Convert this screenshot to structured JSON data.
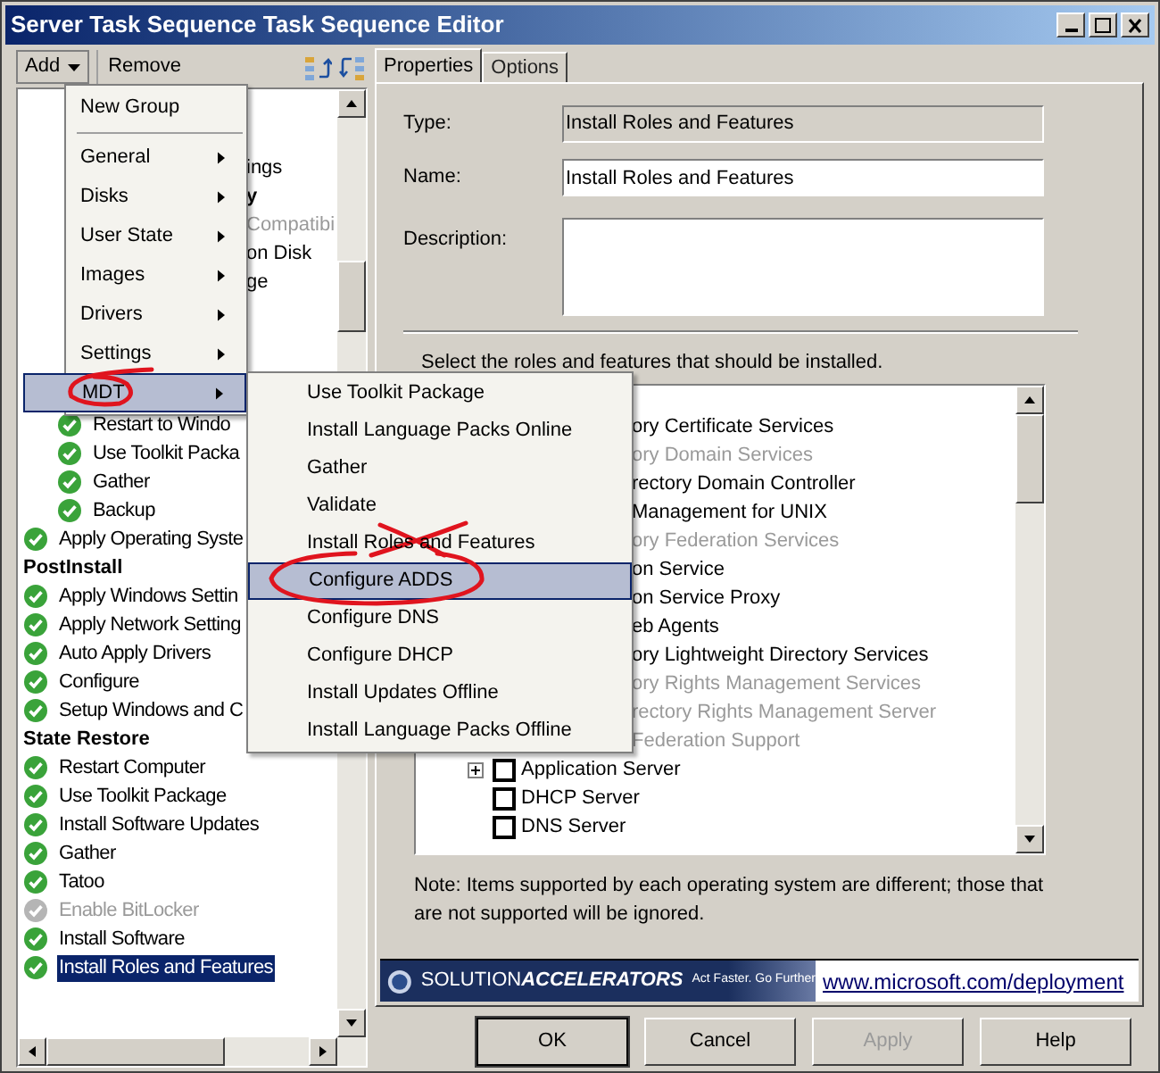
{
  "window": {
    "title": "Server Task Sequence Task Sequence Editor"
  },
  "toolbar": {
    "add_button": "Add",
    "remove_button": "Remove"
  },
  "tree": {
    "rows": [
      {
        "kind": "fragment",
        "label": "ings",
        "bold": false,
        "disabled": false
      },
      {
        "kind": "fragment",
        "label": "y",
        "bold": true,
        "disabled": false
      },
      {
        "kind": "fragment",
        "label": "Compatibi",
        "bold": false,
        "disabled": true
      },
      {
        "kind": "fragment",
        "label": "on Disk",
        "bold": false,
        "disabled": false
      },
      {
        "kind": "fragment",
        "label": "ge",
        "bold": false,
        "disabled": false
      },
      {
        "kind": "covered",
        "children": [
          {
            "kind": "covered",
            "children": [
              {
                "kind": "step",
                "label": "Restart to Windo",
                "disabled": false,
                "selected": false
              },
              {
                "kind": "step",
                "label": "Use Toolkit Packa",
                "disabled": false,
                "selected": false
              },
              {
                "kind": "step",
                "label": "Gather",
                "disabled": false,
                "selected": false
              },
              {
                "kind": "step",
                "label": "Backup",
                "disabled": false,
                "selected": false
              }
            ]
          },
          {
            "kind": "step",
            "label": "Apply Operating Syste",
            "disabled": false,
            "selected": false
          }
        ]
      },
      {
        "kind": "group",
        "label": "PostInstall",
        "children": [
          {
            "kind": "step",
            "label": "Apply Windows Settin",
            "disabled": false,
            "selected": false
          },
          {
            "kind": "step",
            "label": "Apply Network Setting",
            "disabled": false,
            "selected": false
          },
          {
            "kind": "step",
            "label": "Auto Apply Drivers",
            "disabled": false,
            "selected": false
          },
          {
            "kind": "step",
            "label": "Configure",
            "disabled": false,
            "selected": false
          },
          {
            "kind": "step",
            "label": "Setup Windows and C",
            "disabled": false,
            "selected": false
          }
        ]
      },
      {
        "kind": "group",
        "label": "State Restore",
        "children": [
          {
            "kind": "step",
            "label": "Restart Computer",
            "disabled": false,
            "selected": false
          },
          {
            "kind": "step",
            "label": "Use Toolkit Package",
            "disabled": false,
            "selected": false
          },
          {
            "kind": "step",
            "label": "Install Software Updates",
            "disabled": false,
            "selected": false
          },
          {
            "kind": "step",
            "label": "Gather",
            "disabled": false,
            "selected": false
          },
          {
            "kind": "step",
            "label": "Tatoo",
            "disabled": false,
            "selected": false
          },
          {
            "kind": "step",
            "label": "Enable BitLocker",
            "disabled": true,
            "selected": false
          },
          {
            "kind": "step",
            "label": "Install Software",
            "disabled": false,
            "selected": false
          },
          {
            "kind": "step",
            "label": "Install Roles and Features",
            "disabled": false,
            "selected": true
          }
        ]
      }
    ]
  },
  "add_menu": {
    "items": [
      {
        "kind": "item",
        "label": "New Group",
        "submenu": false,
        "selected": false
      },
      {
        "kind": "separator"
      },
      {
        "kind": "item",
        "label": "General",
        "submenu": true,
        "selected": false
      },
      {
        "kind": "item",
        "label": "Disks",
        "submenu": true,
        "selected": false
      },
      {
        "kind": "item",
        "label": "User State",
        "submenu": true,
        "selected": false
      },
      {
        "kind": "item",
        "label": "Images",
        "submenu": true,
        "selected": false
      },
      {
        "kind": "item",
        "label": "Drivers",
        "submenu": true,
        "selected": false
      },
      {
        "kind": "item",
        "label": "Settings",
        "submenu": true,
        "selected": false
      },
      {
        "kind": "item",
        "label": "MDT",
        "submenu": true,
        "selected": true
      }
    ]
  },
  "mdt_submenu": {
    "items": [
      {
        "label": "Use Toolkit Package",
        "selected": false
      },
      {
        "label": "Install Language Packs Online",
        "selected": false
      },
      {
        "label": "Gather",
        "selected": false
      },
      {
        "label": "Validate",
        "selected": false
      },
      {
        "label": "Install Roles and Features",
        "selected": false
      },
      {
        "label": "Configure ADDS",
        "selected": true
      },
      {
        "label": "Configure DNS",
        "selected": false
      },
      {
        "label": "Configure DHCP",
        "selected": false
      },
      {
        "label": "Install Updates Offline",
        "selected": false
      },
      {
        "label": "Install Language Packs Offline",
        "selected": false
      }
    ]
  },
  "tabs": [
    {
      "label": "Properties",
      "selected": true
    },
    {
      "label": "Options",
      "selected": false
    }
  ],
  "form": {
    "type_label": "Type:",
    "type_value": "Install Roles and Features",
    "name_label": "Name:",
    "name_value": "Install Roles and Features",
    "description_label": "Description:"
  },
  "roles": {
    "prompt": "Select the roles and features that should be installed.",
    "items": [
      {
        "kind": "fragment",
        "label": "ory Certificate Services",
        "disabled": false
      },
      {
        "kind": "fragment",
        "label": "ory Domain Services",
        "disabled": true
      },
      {
        "kind": "fragment",
        "label": "rectory Domain Controller",
        "disabled": false
      },
      {
        "kind": "fragment",
        "label": "Management for UNIX",
        "disabled": false
      },
      {
        "kind": "fragment",
        "label": "ory Federation Services",
        "disabled": true
      },
      {
        "kind": "fragment",
        "label": "on Service",
        "disabled": false
      },
      {
        "kind": "fragment",
        "label": "on Service Proxy",
        "disabled": false
      },
      {
        "kind": "fragment",
        "label": "eb Agents",
        "disabled": false
      },
      {
        "kind": "fragment",
        "label": "ory Lightweight Directory Services",
        "disabled": false
      },
      {
        "kind": "fragment",
        "label": "ory Rights Management Services",
        "disabled": true
      },
      {
        "kind": "fragment",
        "label": "rectory Rights Management Server",
        "disabled": true
      },
      {
        "kind": "fragment",
        "label": "Federation Support",
        "disabled": true
      },
      {
        "kind": "role",
        "label": "Application Server",
        "checked": false,
        "expandable": true
      },
      {
        "kind": "role",
        "label": "DHCP Server",
        "checked": false,
        "expandable": false
      },
      {
        "kind": "role",
        "label": "DNS Server",
        "checked": false,
        "expandable": false
      }
    ]
  },
  "note": "Note:  Items supported by each operating system are different; those that are not supported will be ignored.",
  "banner": {
    "brand_prefix": "SOLUTION",
    "brand_suffix": "ACCELERATORS",
    "tagline": "Act Faster. Go Further",
    "link": "www.microsoft.com/deployment"
  },
  "buttons": [
    {
      "label": "OK",
      "disabled": false,
      "default": true
    },
    {
      "label": "Cancel",
      "disabled": false,
      "default": false
    },
    {
      "label": "Apply",
      "disabled": true,
      "default": false
    },
    {
      "label": "Help",
      "disabled": false,
      "default": false
    }
  ]
}
